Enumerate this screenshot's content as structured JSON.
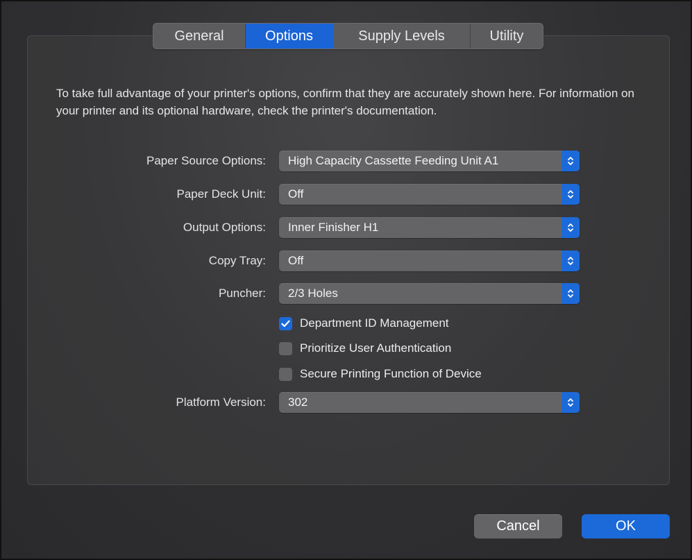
{
  "tabs": [
    {
      "label": "General"
    },
    {
      "label": "Options",
      "active": true
    },
    {
      "label": "Supply Levels"
    },
    {
      "label": "Utility"
    }
  ],
  "intro_text": "To take full advantage of your printer's options, confirm that they are accurately shown here. For information on your printer and its optional hardware, check the printer's documentation.",
  "options": {
    "paper_source": {
      "label": "Paper Source Options:",
      "value": "High Capacity Cassette Feeding Unit A1"
    },
    "paper_deck": {
      "label": "Paper Deck Unit:",
      "value": "Off"
    },
    "output": {
      "label": "Output Options:",
      "value": "Inner Finisher H1"
    },
    "copy_tray": {
      "label": "Copy Tray:",
      "value": "Off"
    },
    "puncher": {
      "label": "Puncher:",
      "value": "2/3 Holes"
    },
    "platform": {
      "label": "Platform Version:",
      "value": "302"
    }
  },
  "checkboxes": {
    "dept_id": {
      "label": "Department ID Management",
      "checked": true
    },
    "prioritize_auth": {
      "label": "Prioritize User Authentication",
      "checked": false
    },
    "secure_print": {
      "label": "Secure Printing Function of Device",
      "checked": false
    }
  },
  "buttons": {
    "cancel": "Cancel",
    "ok": "OK"
  },
  "colors": {
    "accent": "#1c6ad9",
    "window_bg": "#2f2f31",
    "control_bg": "#646466",
    "text": "#e7e7e8"
  },
  "icons": {
    "popup_arrows": "chevron-up-down-icon",
    "check": "checkmark-icon"
  }
}
